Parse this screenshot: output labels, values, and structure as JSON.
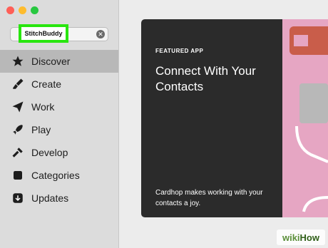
{
  "window": {
    "controls": [
      "close",
      "minimize",
      "zoom"
    ]
  },
  "search": {
    "value": "StitchBuddy",
    "clear_icon": "clear-circle-icon"
  },
  "sidebar": {
    "items": [
      {
        "label": "Discover",
        "icon": "star-icon",
        "active": true
      },
      {
        "label": "Create",
        "icon": "brush-icon",
        "active": false
      },
      {
        "label": "Work",
        "icon": "paper-plane-icon",
        "active": false
      },
      {
        "label": "Play",
        "icon": "rocket-icon",
        "active": false
      },
      {
        "label": "Develop",
        "icon": "hammer-icon",
        "active": false
      },
      {
        "label": "Categories",
        "icon": "stack-icon",
        "active": false
      },
      {
        "label": "Updates",
        "icon": "download-icon",
        "active": false
      }
    ]
  },
  "featured": {
    "label": "FEATURED APP",
    "title": "Connect With Your Contacts",
    "subtitle": "Cardhop makes working with your contacts a joy."
  },
  "watermark": {
    "wiki": "wiki",
    "how": "How"
  },
  "colors": {
    "highlight": "#29e60f",
    "card": "#2b2b2b",
    "art": "#e6a6c3"
  }
}
